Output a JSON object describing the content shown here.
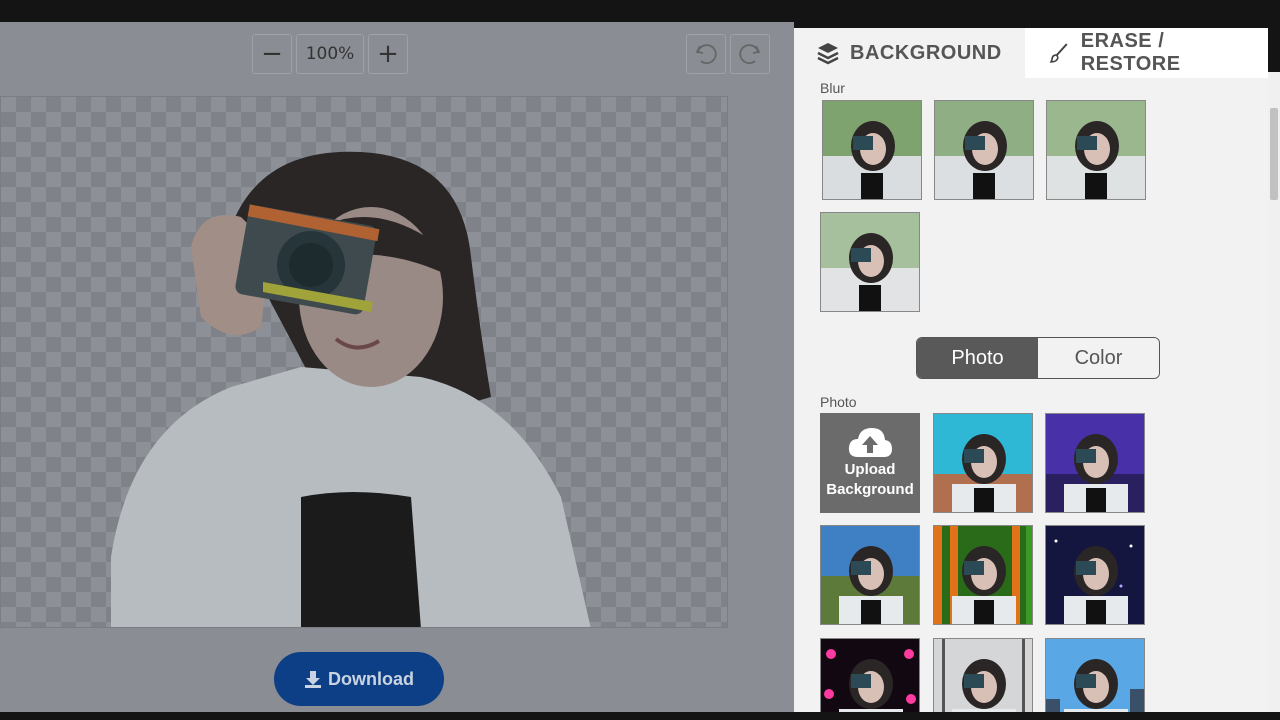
{
  "editor": {
    "zoom_out_symbol": "−",
    "zoom_value": "100%",
    "zoom_in_symbol": "+",
    "undo_icon": "undo-icon",
    "redo_icon": "redo-icon",
    "download_label": "Download"
  },
  "panel": {
    "tabs": [
      {
        "label": "BACKGROUND",
        "icon": "layers-icon"
      },
      {
        "label": "ERASE / RESTORE",
        "icon": "brush-icon"
      }
    ],
    "blur_label": "Blur",
    "toggle": {
      "photo": "Photo",
      "color": "Color",
      "selected": "Photo"
    },
    "photo_label": "Photo",
    "upload_line1": "Upload",
    "upload_line2": "Background"
  },
  "colors": {
    "download_bg": "#0d3f86",
    "toggle_active": "#595959"
  }
}
